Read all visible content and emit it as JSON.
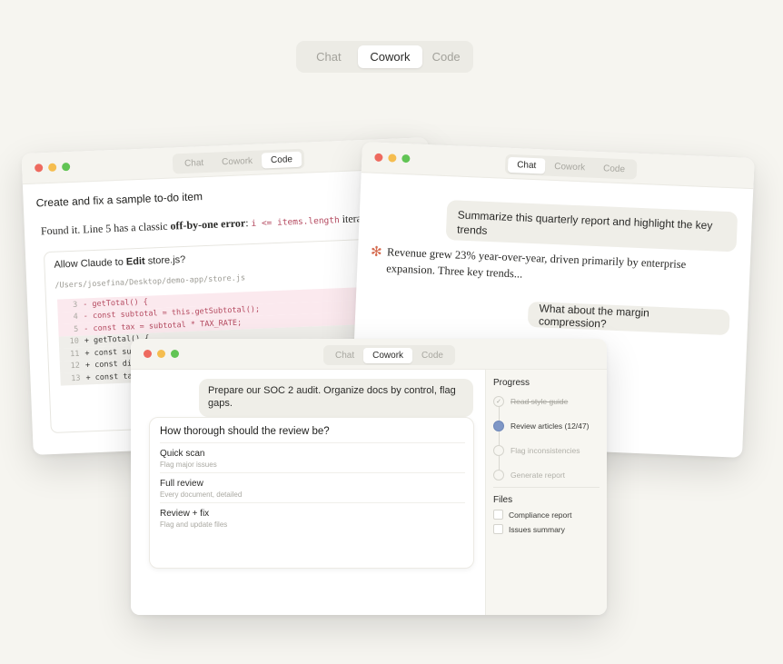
{
  "top_tabs": [
    "Chat",
    "Cowork",
    "Code"
  ],
  "code_window": {
    "tabs": [
      "Chat",
      "Cowork",
      "Code"
    ],
    "title": "Create and fix a sample to-do item",
    "found_prefix": "Found it. Line 5 has a classic ",
    "found_bold": "off-by-one error",
    "found_colon": ": ",
    "found_code": "i <= items.length",
    "found_suffix": " iterat",
    "permission_prefix": "Allow Claude to ",
    "permission_bold": "Edit",
    "permission_suffix": " store.js?",
    "path": "/Users/josefina/Desktop/demo-app/store.js",
    "diff": [
      {
        "ln": "3",
        "text": "- getTotal() {",
        "type": "del"
      },
      {
        "ln": "4",
        "text": "- const subtotal = this.getSubtotal();",
        "type": "del"
      },
      {
        "ln": "5",
        "text": "- const tax = subtotal * TAX_RATE;",
        "type": "del"
      },
      {
        "ln": "10",
        "text": "+ getTotal() {",
        "type": "add"
      },
      {
        "ln": "11",
        "text": "+ const subt",
        "type": "add"
      },
      {
        "ln": "12",
        "text": "+ const disc",
        "type": "add"
      },
      {
        "ln": "13",
        "text": "+ const tax",
        "type": "add"
      }
    ]
  },
  "chat_window": {
    "tabs": [
      "Chat",
      "Cowork",
      "Code"
    ],
    "user_message": "Summarize this quarterly report and highlight the key trends",
    "assistant_reply": "Revenue grew 23% year-over-year, driven primarily by enterprise expansion. Three key trends...",
    "follow_up": "What about the margin compression?"
  },
  "cowork_window": {
    "tabs": [
      "Chat",
      "Cowork",
      "Code"
    ],
    "user_message": "Prepare our SOC 2 audit. Organize docs by control, flag gaps.",
    "question": "How thorough should the review be?",
    "options": [
      {
        "title": "Quick scan",
        "subtitle": "Flag major issues"
      },
      {
        "title": "Full review",
        "subtitle": "Every document, detailed"
      },
      {
        "title": "Review + fix",
        "subtitle": "Flag and update files"
      }
    ],
    "progress_heading": "Progress",
    "steps": [
      {
        "label": "Read style guide",
        "state": "done"
      },
      {
        "label": "Review articles (12/47)",
        "state": "current"
      },
      {
        "label": "Flag inconsistencies",
        "state": "pending"
      },
      {
        "label": "Generate report",
        "state": "pending"
      }
    ],
    "files_heading": "Files",
    "files": [
      "Compliance report",
      "Issues summary"
    ]
  },
  "colors": {
    "background": "#f6f5f0",
    "diff_removed": "#fbe9ee",
    "progress_current": "#7f97c6",
    "claude_star": "#d56b4f"
  },
  "icons": {
    "assistant": "claude-star-icon",
    "step_done": "check-icon"
  }
}
